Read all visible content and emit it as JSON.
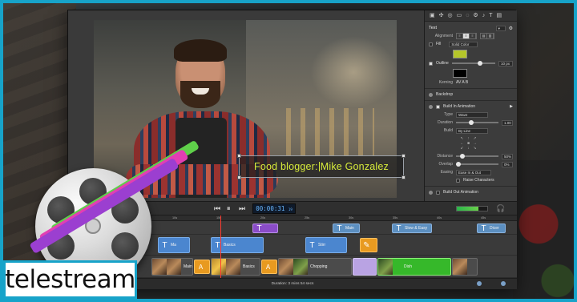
{
  "inspector": {
    "toolbar_icons": [
      "canvas-icon",
      "media-icon",
      "annotations-icon",
      "transitions-icon",
      "animations-icon",
      "behaviors-icon",
      "audio-icon",
      "captions-icon",
      "text-icon",
      "settings-icon"
    ],
    "section_title": "Text",
    "alignment_label": "Alignment",
    "fill_label": "Fill",
    "fill_type": "Solid Color",
    "fill_color": "#b5c62a",
    "outline_label": "Outline",
    "outline_value": "10 px",
    "outline_color": "#000000",
    "kerning_label": "Kerning",
    "kerning_value": "AV A B",
    "backdrop_label": "Backdrop",
    "build_in_label": "Build In Animation",
    "type_label": "Type",
    "type_value": "Wave",
    "duration_label": "Duration",
    "duration_value": "1.00",
    "build_label": "Build",
    "build_value": "By Line",
    "distance_label": "Distance",
    "distance_value": "50%",
    "overlap_label": "Overlap",
    "overlap_value": "0%",
    "easing_label": "Easing",
    "easing_value": "Ease In & Out",
    "reverse_label": "Raise Characters",
    "build_out_label": "Build Out Animation"
  },
  "caption": {
    "text_before": "Food blogger: ",
    "text_after": "Mike Gonzalez"
  },
  "transport": {
    "timecode": "00:00:31",
    "timecode_frames": "19"
  },
  "timeline": {
    "ruler_ticks": [
      "0",
      "5s",
      "10s",
      "15s",
      "20s",
      "25s",
      "30s",
      "35s",
      "40s",
      "45s"
    ],
    "annotations": [
      "",
      "Main",
      "Slow & Easy",
      "Dicer"
    ],
    "titles": [
      "Ma",
      "Basics",
      "Stirr"
    ],
    "video_clips": [
      "Main",
      "Basics",
      "Chopping",
      "Dish"
    ],
    "status": "Duration: 3 mins 54 secs"
  },
  "branding": {
    "company": "telestream"
  }
}
